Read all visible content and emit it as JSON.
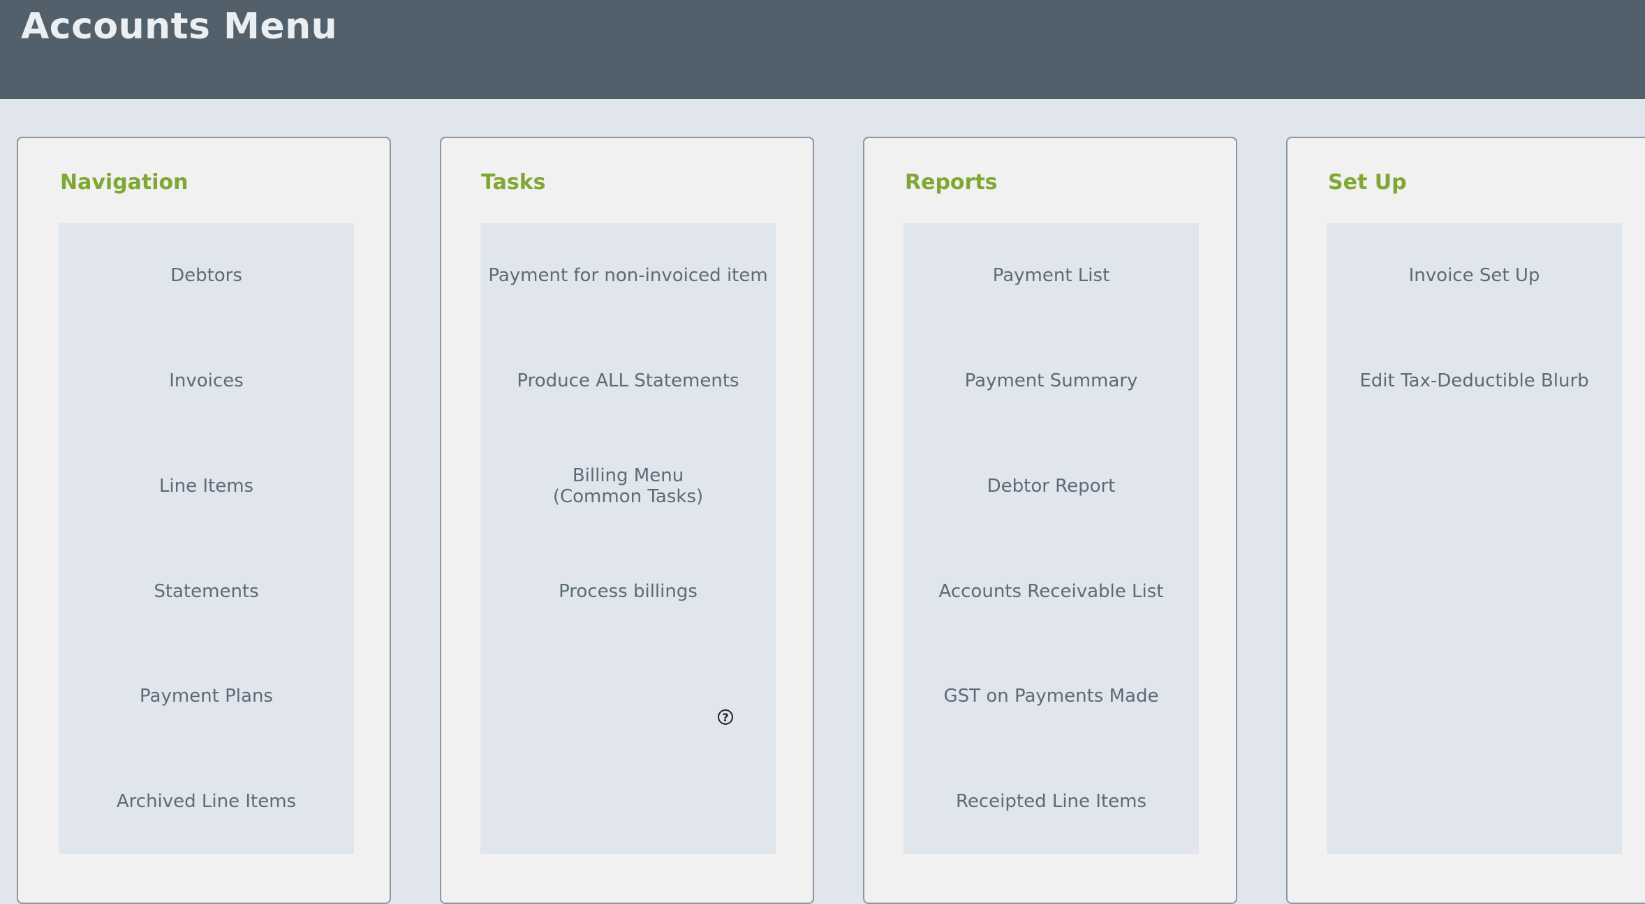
{
  "header": {
    "title": "Accounts Menu"
  },
  "panels": [
    {
      "title": "Navigation",
      "items": [
        "Debtors",
        "Invoices",
        "Line Items",
        "Statements",
        "Payment Plans",
        "Archived Line Items"
      ]
    },
    {
      "title": "Tasks",
      "items": [
        "Payment for non-invoiced item",
        "Produce ALL Statements",
        "Billing Menu\n(Common Tasks)",
        "Process billings"
      ]
    },
    {
      "title": "Reports",
      "items": [
        "Payment List",
        "Payment Summary",
        "Debtor Report",
        "Accounts Receivable List",
        "GST on Payments Made",
        "Receipted Line Items"
      ]
    },
    {
      "title": "Set Up",
      "items": [
        "Invoice Set Up",
        "Edit Tax-Deductible Blurb"
      ]
    }
  ],
  "help_icon": {
    "glyph": "?",
    "icon": "help-circle-icon"
  },
  "colors": {
    "header_bg": "#52606c",
    "page_bg": "#e1e6ed",
    "panel_bg": "#f1f1f1",
    "panel_title": "#7fa833",
    "item_text": "#5c6b78"
  }
}
